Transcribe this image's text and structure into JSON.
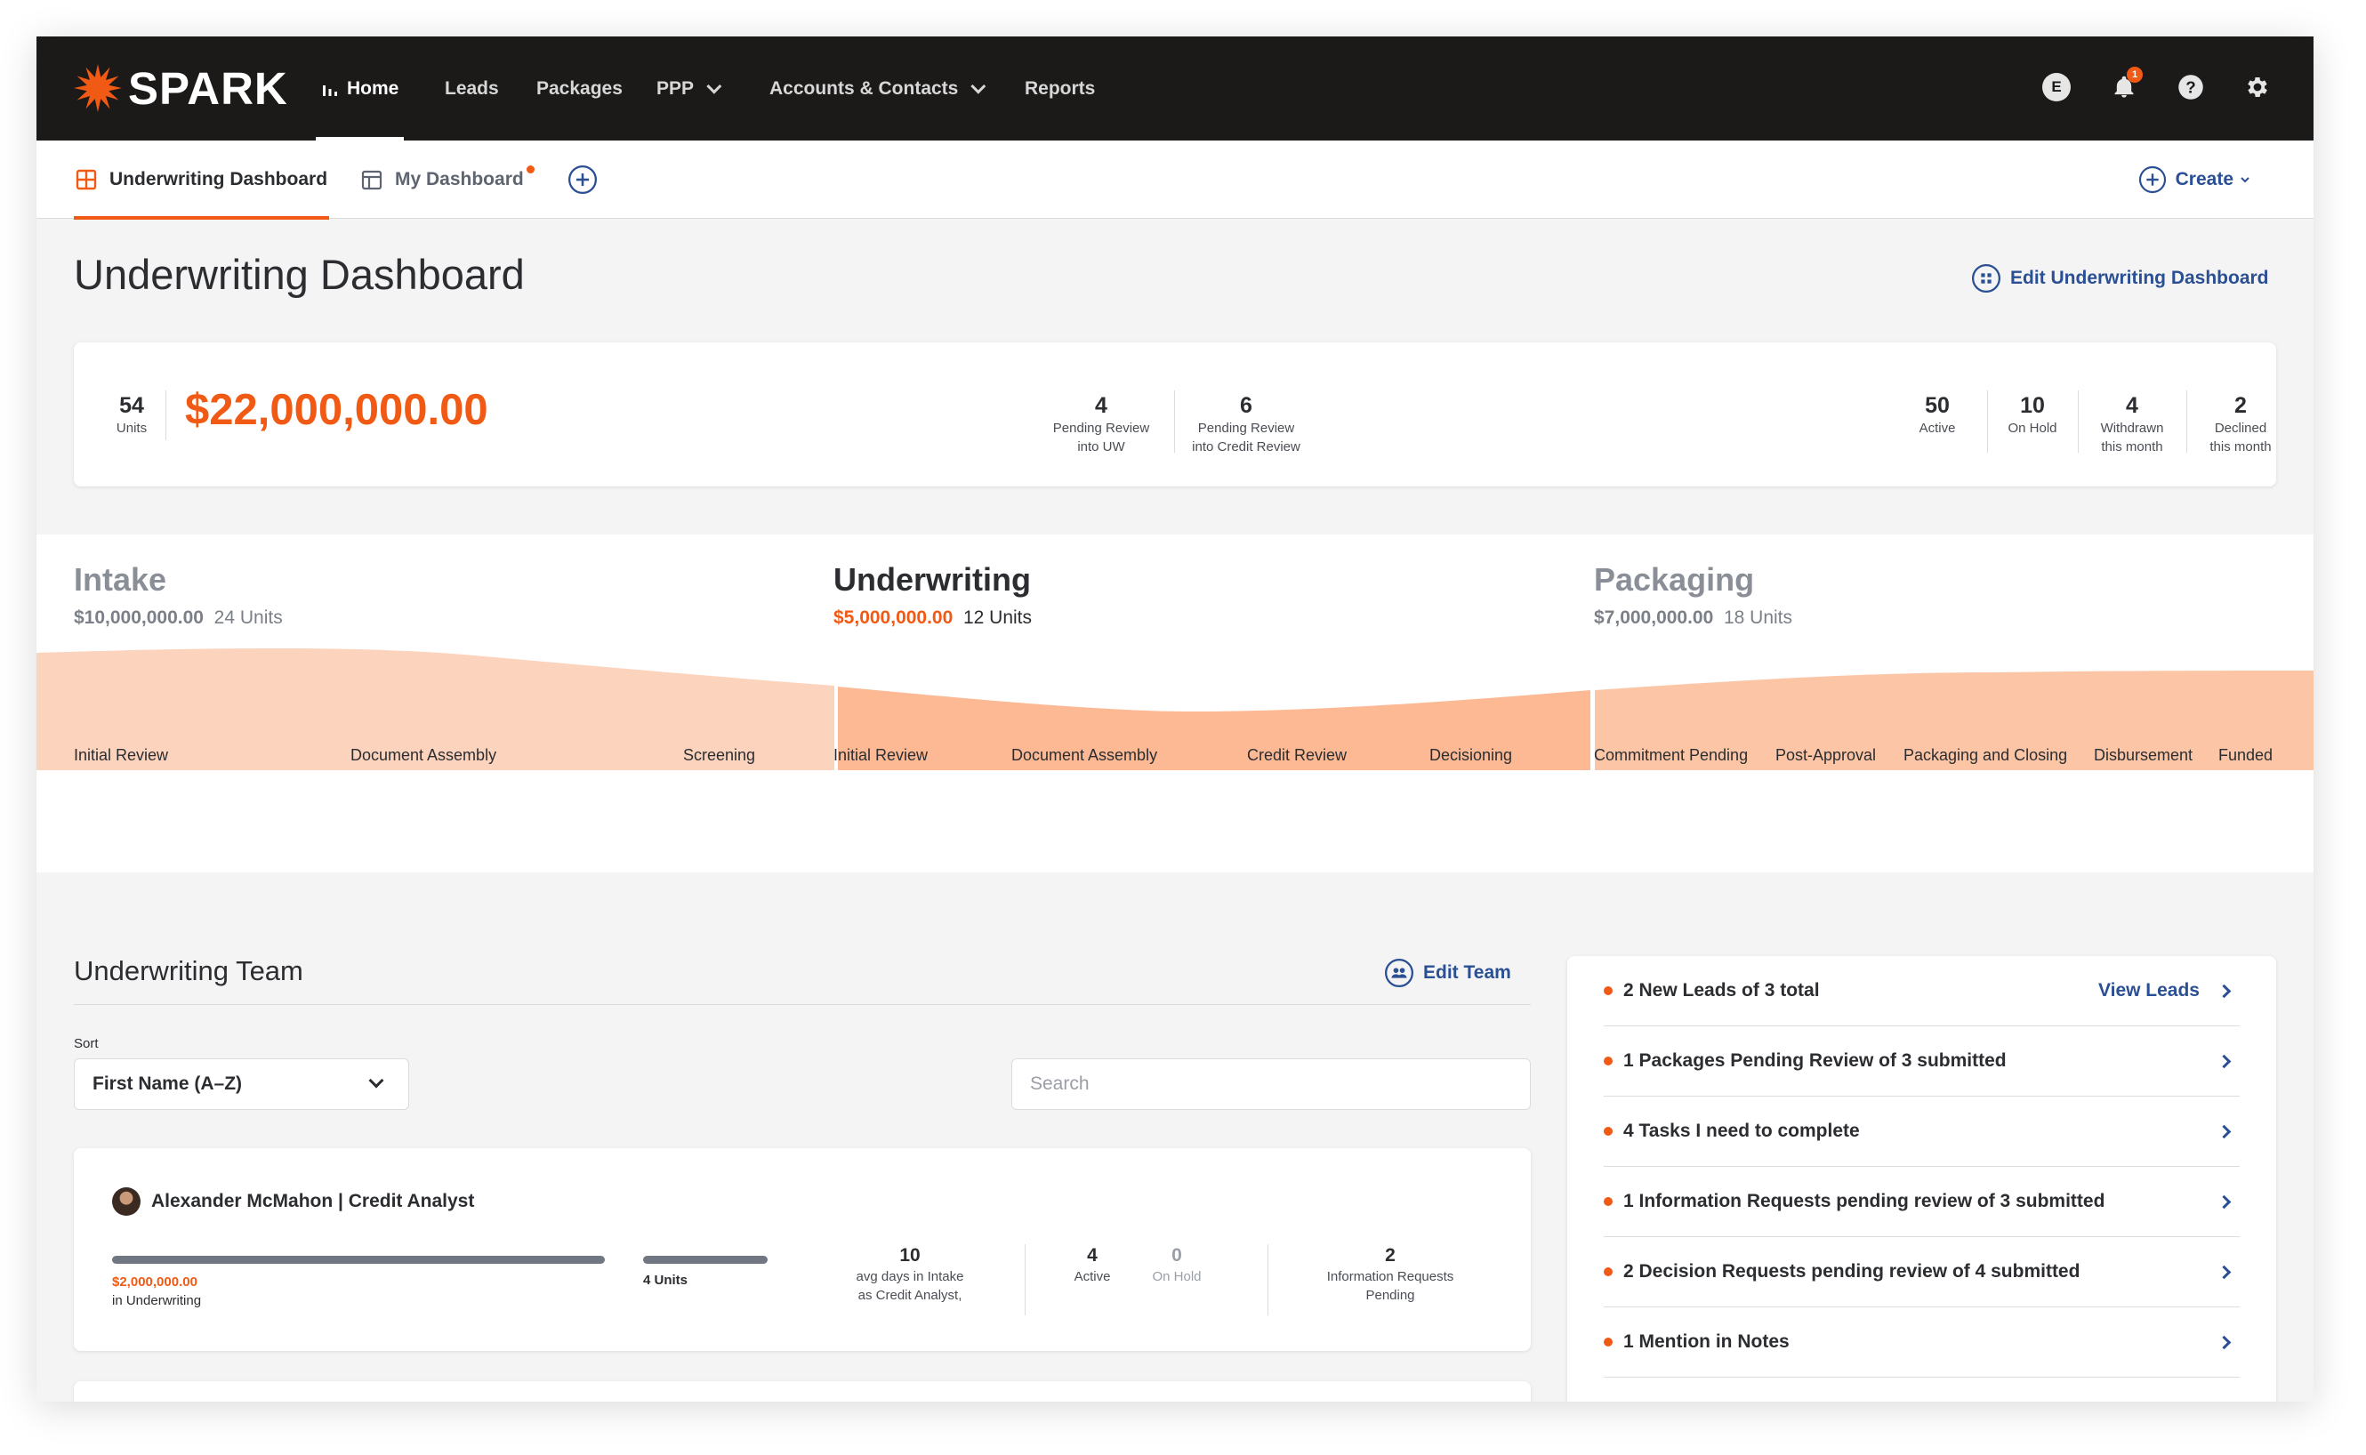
{
  "app": {
    "logo": "SPARK"
  },
  "nav": {
    "items": [
      {
        "label": "Home",
        "icon": "bar-chart-icon"
      },
      {
        "label": "Leads"
      },
      {
        "label": "Packages"
      },
      {
        "label": "PPP",
        "dropdown": true
      },
      {
        "label": "Accounts & Contacts",
        "dropdown": true
      },
      {
        "label": "Reports"
      }
    ],
    "user_initial": "E",
    "notification_count": "1"
  },
  "tabs": {
    "items": [
      {
        "label": "Underwriting Dashboard"
      },
      {
        "label": "My Dashboard"
      }
    ],
    "create_label": "Create"
  },
  "page": {
    "title": "Underwriting Dashboard",
    "edit_label": "Edit Underwriting Dashboard"
  },
  "summary": {
    "units": {
      "value": "54",
      "label": "Units"
    },
    "amount": "$22,000,000.00",
    "pending_uw": {
      "value": "4",
      "label1": "Pending Review",
      "label2": "into UW"
    },
    "pending_credit": {
      "value": "6",
      "label1": "Pending Review",
      "label2": "into Credit Review"
    },
    "active": {
      "value": "50",
      "label": "Active"
    },
    "on_hold": {
      "value": "10",
      "label": "On Hold"
    },
    "withdrawn": {
      "value": "4",
      "label1": "Withdrawn",
      "label2": "this month"
    },
    "declined": {
      "value": "2",
      "label1": "Declined",
      "label2": "this month"
    }
  },
  "pipeline": {
    "stages": [
      {
        "title": "Intake",
        "amount": "$10,000,000.00",
        "units": "24 Units"
      },
      {
        "title": "Underwriting",
        "amount": "$5,000,000.00",
        "units": "12 Units"
      },
      {
        "title": "Packaging",
        "amount": "$7,000,000.00",
        "units": "18 Units"
      }
    ],
    "steps": [
      "Initial Review",
      "Document Assembly",
      "Screening",
      "Initial Review",
      "Document Assembly",
      "Credit Review",
      "Decisioning",
      "Commitment Pending",
      "Post-Approval",
      "Packaging and Closing",
      "Disbursement",
      "Funded"
    ],
    "colors": {
      "light": "#fcd3bd",
      "dark": "#fcb994"
    }
  },
  "team": {
    "title": "Underwriting Team",
    "edit_label": "Edit Team",
    "sort_label": "Sort",
    "sort_value": "First Name (A–Z)",
    "search_placeholder": "Search",
    "members": [
      {
        "name": "Alexander McMahon | Credit Analyst",
        "amount": "$2,000,000.00",
        "amount_label": "in Underwriting",
        "units": "4 Units",
        "avg_days": "10",
        "avg_days_label1": "avg days in Intake",
        "avg_days_label2": "as Credit Analyst,",
        "active": "4",
        "active_label": "Active",
        "on_hold": "0",
        "on_hold_label": "On Hold",
        "info_requests": "2",
        "info_label1": "Information Requests",
        "info_label2": "Pending"
      }
    ]
  },
  "notifications": [
    {
      "text": "2 New Leads of 3 total",
      "link": "View Leads"
    },
    {
      "text": "1 Packages Pending Review of 3 submitted"
    },
    {
      "text": "4 Tasks I need to complete"
    },
    {
      "text": "1 Information Requests pending review of 3 submitted"
    },
    {
      "text": "2 Decision Requests pending review of 4 submitted"
    },
    {
      "text": "1 Mention in Notes"
    }
  ],
  "colors": {
    "accent": "#f05a14",
    "link": "#2a4f93",
    "nav_bg": "#1c1a19"
  }
}
